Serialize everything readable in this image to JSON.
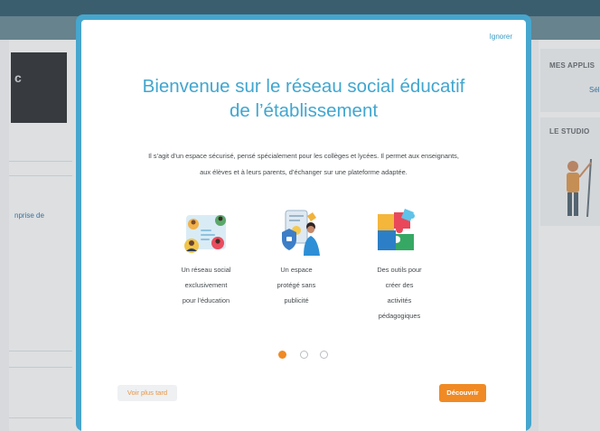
{
  "background": {
    "left_photo_text": "c",
    "left_text": "nprise de",
    "right_section_1": "MES APPLIS",
    "right_link": "Séle",
    "right_section_2": "LE STUDIO"
  },
  "modal": {
    "ignore_label": "Ignorer",
    "title_line1": "Bienvenue sur le réseau social éducatif",
    "title_line2": "de l’établissement",
    "intro_line1": "Il s’agit d’un espace sécurisé, pensé spécialement pour les collèges et lycées. Il permet aux enseignants,",
    "intro_line2": "aux élèves et à leurs parents, d’échanger sur une plateforme adaptée.",
    "features": [
      {
        "icon": "social-network-icon",
        "lines": [
          "Un réseau social",
          "exclusivement",
          "pour l’éducation"
        ]
      },
      {
        "icon": "protected-space-icon",
        "lines": [
          "Un espace",
          "protégé sans",
          "publicité"
        ]
      },
      {
        "icon": "puzzle-tools-icon",
        "lines": [
          "Des outils pour",
          "créer des",
          "activités",
          "pédagogiques"
        ]
      }
    ],
    "pagination": {
      "current": 1,
      "total": 3
    },
    "later_label": "Voir plus tard",
    "discover_label": "Découvrir"
  },
  "colors": {
    "accent_blue": "#41a6cf",
    "frame_blue": "#46a6cd",
    "accent_orange": "#f08a24"
  }
}
